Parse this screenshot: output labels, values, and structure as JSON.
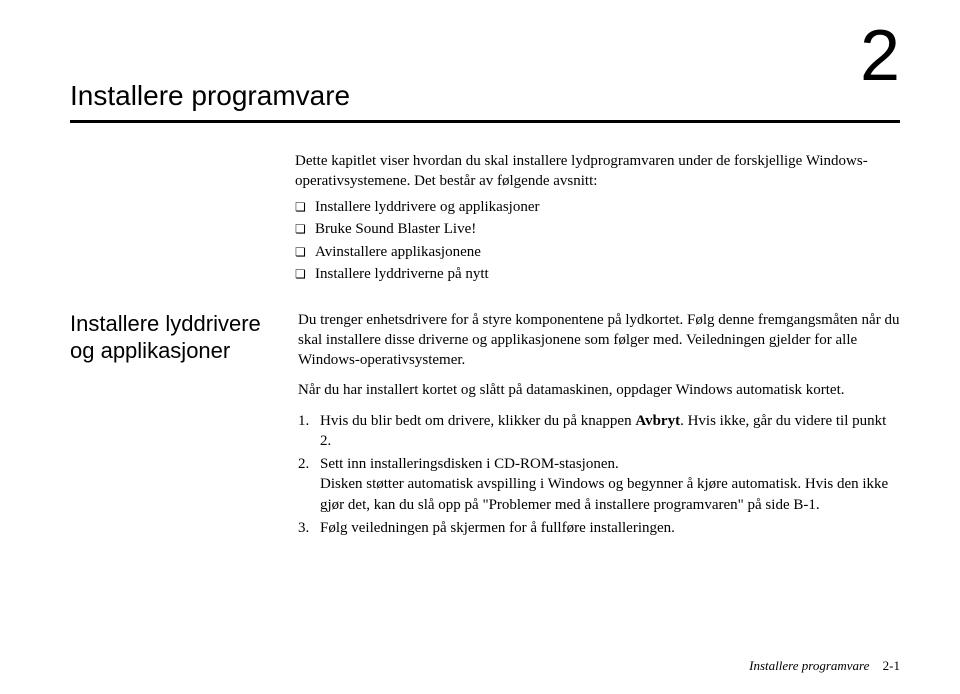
{
  "chapter": {
    "title": "Installere programvare",
    "number": "2"
  },
  "intro": {
    "text": "Dette kapitlet viser hvordan du skal installere lydprogramvaren under de forskjellige Windows-operativsystemene. Det består av følgende avsnitt:",
    "bullets": [
      "Installere lyddrivere og applikasjoner",
      "Bruke Sound Blaster Live!",
      "Avinstallere applikasjonene",
      "Installere lyddriverne på nytt"
    ]
  },
  "section": {
    "heading": "Installere lyddrivere og applikasjoner",
    "para1": "Du trenger enhetsdrivere for å styre komponentene på lydkortet. Følg denne fremgangsmåten når du skal installere disse driverne og applikasjonene som følger med. Veiledningen gjelder for alle Windows-operativsystemer.",
    "para2": "Når du har installert kortet og slått på datamaskinen, oppdager Windows automatisk kortet.",
    "steps": [
      {
        "num": "1.",
        "text_a": "Hvis du blir bedt om drivere, klikker du på knappen ",
        "bold": "Avbryt",
        "text_b": ". Hvis ikke, går du videre til punkt 2."
      },
      {
        "num": "2.",
        "text_a": "Sett inn installeringsdisken i CD-ROM-stasjonen.",
        "bold": "",
        "text_b": "",
        "extra": "Disken støtter automatisk avspilling i Windows og begynner å kjøre automatisk. Hvis den ikke gjør det, kan du slå opp på \"Problemer med å installere programvaren\" på side B-1."
      },
      {
        "num": "3.",
        "text_a": "Følg veiledningen på skjermen for å fullføre installeringen.",
        "bold": "",
        "text_b": ""
      }
    ]
  },
  "footer": {
    "label": "Installere programvare",
    "page": "2-1"
  }
}
